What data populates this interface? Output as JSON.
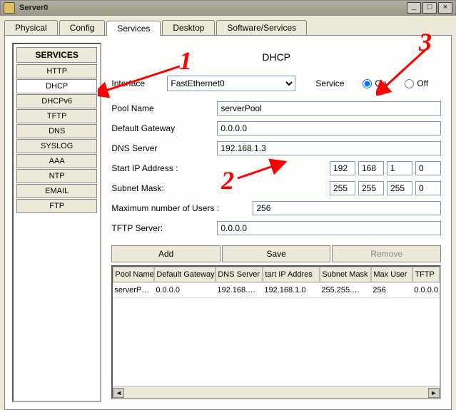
{
  "window": {
    "title": "Server0"
  },
  "tabs": [
    "Physical",
    "Config",
    "Services",
    "Desktop",
    "Software/Services"
  ],
  "active_tab": 2,
  "sidebar": {
    "header": "SERVICES",
    "items": [
      "HTTP",
      "DHCP",
      "DHCPv6",
      "TFTP",
      "DNS",
      "SYSLOG",
      "AAA",
      "NTP",
      "EMAIL",
      "FTP"
    ],
    "active_index": 1
  },
  "panel": {
    "title": "DHCP",
    "interface_label": "Interface",
    "interface_value": "FastEthernet0",
    "service_label": "Service",
    "on_label": "On",
    "off_label": "Off",
    "service_on": true,
    "pool_name_label": "Pool Name",
    "pool_name": "serverPool",
    "gateway_label": "Default Gateway",
    "gateway": "0.0.0.0",
    "dns_label": "DNS Server",
    "dns": "192.168.1.3",
    "start_ip_label": "Start IP Address :",
    "start_ip": [
      "192",
      "168",
      "1",
      "0"
    ],
    "mask_label": "Subnet Mask:",
    "mask": [
      "255",
      "255",
      "255",
      "0"
    ],
    "max_users_label": "Maximum number of Users :",
    "max_users": "256",
    "tftp_label": "TFTP Server:",
    "tftp": "0.0.0.0",
    "buttons": {
      "add": "Add",
      "save": "Save",
      "remove": "Remove"
    },
    "table": {
      "headers": [
        "Pool Name",
        "Default Gateway",
        "DNS Server",
        "Start IP Address",
        "Subnet Mask",
        "Max User",
        "TFTP"
      ],
      "header_display": [
        "Pool Name",
        "Default Gateway",
        "DNS Server",
        "tart IP Addres",
        "Subnet Mask",
        "Max User",
        "TFTP"
      ],
      "rows": [
        {
          "pool": "serverP…",
          "gw": "0.0.0.0",
          "dns": "192.168.…",
          "start": "192.168.1.0",
          "mask": "255.255.…",
          "max": "256",
          "tftp": "0.0.0.0"
        }
      ]
    }
  },
  "annotations": {
    "1": "1",
    "2": "2",
    "3": "3"
  }
}
